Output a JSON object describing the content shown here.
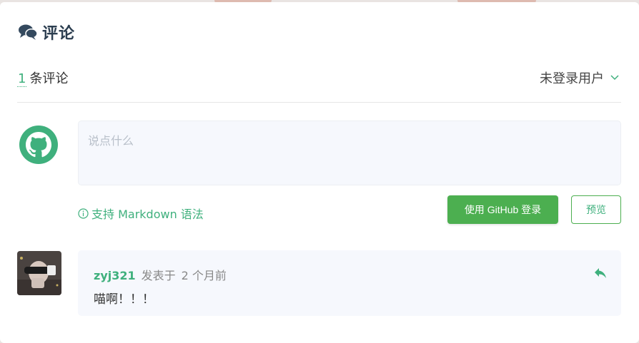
{
  "header": {
    "title": "评论",
    "icon": "comments-icon"
  },
  "stats": {
    "count": "1",
    "label": "条评论"
  },
  "user_menu": {
    "label": "未登录用户",
    "icon": "chevron-down-icon"
  },
  "editor": {
    "placeholder": "说点什么",
    "avatar_icon": "github-icon"
  },
  "markdown_hint": {
    "label": "支持 Markdown 语法",
    "icon": "info-circle-icon"
  },
  "buttons": {
    "login": "使用 GitHub 登录",
    "preview": "预览"
  },
  "comments": [
    {
      "author": "zyj321",
      "posted_label": "发表于",
      "time": "2 个月前",
      "content": "喵啊！！！",
      "reply_icon": "reply-icon"
    }
  ],
  "colors": {
    "accent": "#3fb07d",
    "button": "#4caf50",
    "text": "#34495e",
    "panel": "#f6f8fd"
  }
}
